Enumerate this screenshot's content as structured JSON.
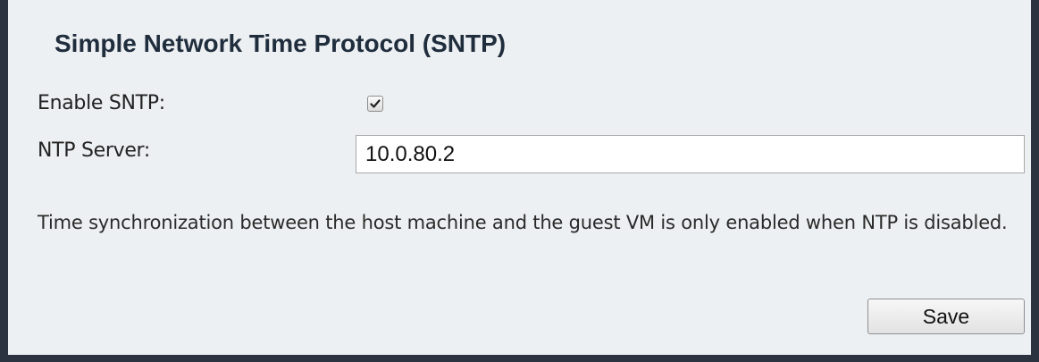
{
  "panel": {
    "title": "Simple Network Time Protocol (SNTP)"
  },
  "form": {
    "enable_sntp_label": "Enable SNTP:",
    "enable_sntp_checked": true,
    "ntp_server_label": "NTP Server:",
    "ntp_server_value": "10.0.80.2"
  },
  "note": "Time synchronization between the host machine and the guest VM is only enabled when NTP is disabled.",
  "actions": {
    "save_label": "Save"
  },
  "colors": {
    "panel_background": "#edf0f2",
    "frame_border": "#2b3340",
    "title_text": "#1f2d3d"
  },
  "icons": {
    "checkbox": "check-icon"
  }
}
